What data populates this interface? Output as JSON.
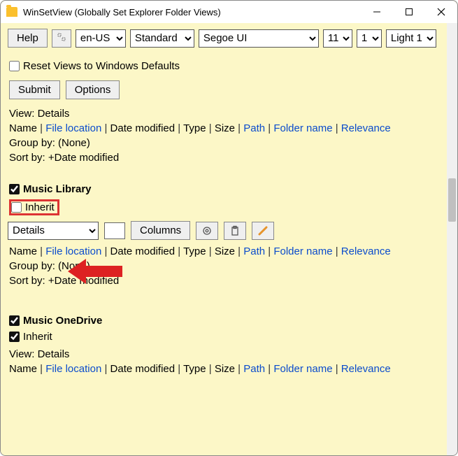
{
  "window": {
    "title": "WinSetView (Globally Set Explorer Folder Views)"
  },
  "topbar": {
    "help": "Help",
    "lang": "en-US",
    "preset": "Standard",
    "font": "Segoe UI",
    "size1": "11",
    "size2": "1",
    "weight": "Light 1"
  },
  "reset": {
    "label": "Reset Views to Windows Defaults",
    "checked": false
  },
  "actions": {
    "submit": "Submit",
    "options": "Options"
  },
  "top_section": {
    "view": "View: Details",
    "group": "Group by: (None)",
    "sort": "Sort by: +Date modified"
  },
  "cols_parts": [
    {
      "t": "Name",
      "l": false
    },
    {
      "t": " | ",
      "s": true
    },
    {
      "t": "File location",
      "l": true
    },
    {
      "t": " | ",
      "s": true
    },
    {
      "t": "Date modified",
      "l": false
    },
    {
      "t": " | ",
      "s": true
    },
    {
      "t": "Type",
      "l": false
    },
    {
      "t": " | ",
      "s": true
    },
    {
      "t": "Size",
      "l": false
    },
    {
      "t": " | ",
      "s": true
    },
    {
      "t": "Path",
      "l": true
    },
    {
      "t": " | ",
      "s": true
    },
    {
      "t": "Folder name",
      "l": true
    },
    {
      "t": " | ",
      "s": true
    },
    {
      "t": "Relevance",
      "l": true
    }
  ],
  "music_library": {
    "title": "Music Library",
    "checked": true,
    "inherit_label": "Inherit",
    "inherit_checked": false,
    "view_select": "Details",
    "columns_btn": "Columns",
    "group": "Group by: (None)",
    "sort": "Sort by: +Date modified"
  },
  "music_onedrive": {
    "title": "Music OneDrive",
    "checked": true,
    "inherit_label": "Inherit",
    "inherit_checked": true,
    "view": "View: Details"
  }
}
